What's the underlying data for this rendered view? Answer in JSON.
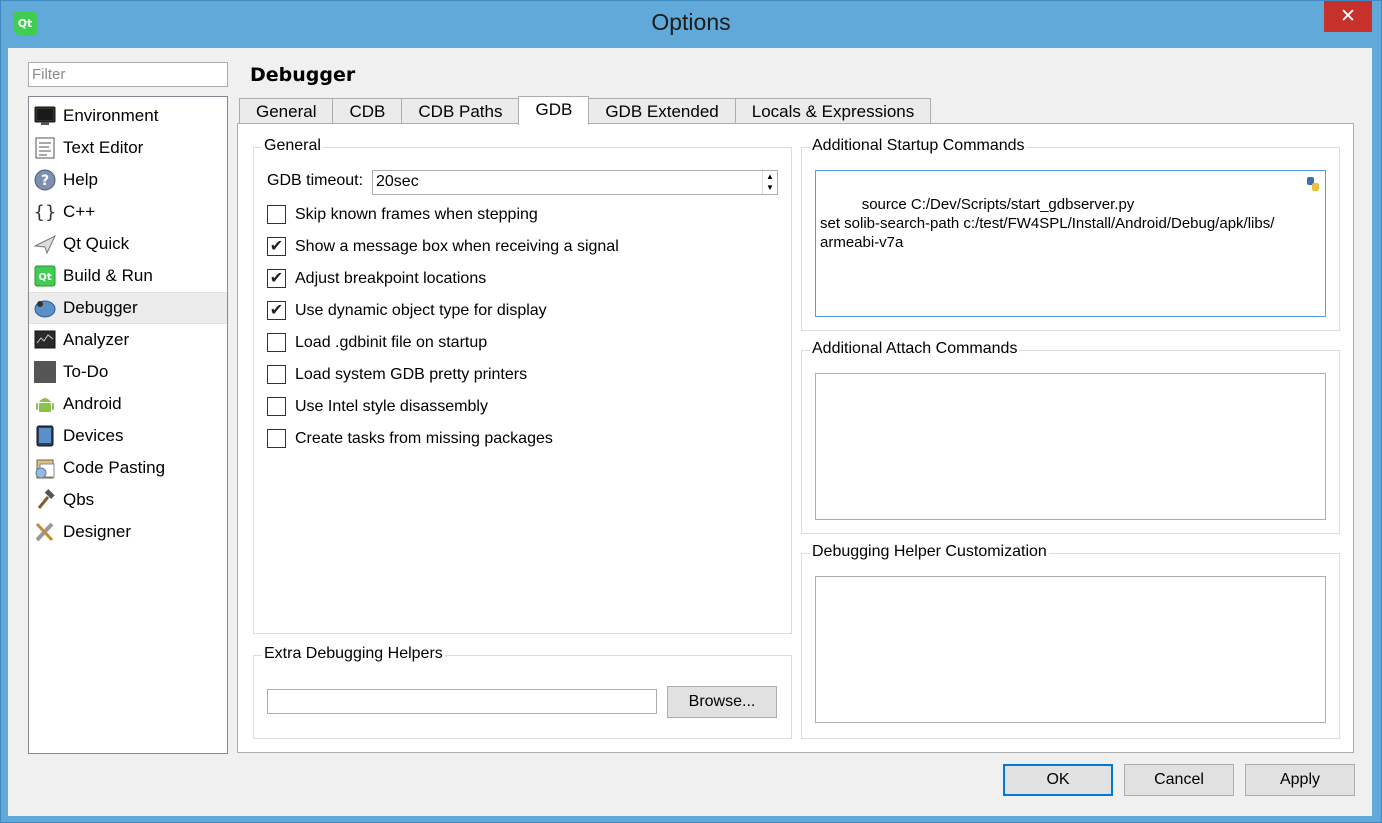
{
  "window": {
    "title": "Options",
    "app_icon_text": "Qt",
    "close_glyph": "✕"
  },
  "filter": {
    "placeholder": "Filter",
    "value": ""
  },
  "categories": [
    {
      "label": "Environment",
      "icon": "monitor-icon"
    },
    {
      "label": "Text Editor",
      "icon": "text-editor-icon"
    },
    {
      "label": "Help",
      "icon": "help-icon"
    },
    {
      "label": "C++",
      "icon": "cpp-braces-icon"
    },
    {
      "label": "Qt Quick",
      "icon": "qt-quick-icon"
    },
    {
      "label": "Build & Run",
      "icon": "build-run-icon"
    },
    {
      "label": "Debugger",
      "icon": "debugger-bug-icon",
      "selected": true
    },
    {
      "label": "Analyzer",
      "icon": "analyzer-icon"
    },
    {
      "label": "To-Do",
      "icon": "todo-icon"
    },
    {
      "label": "Android",
      "icon": "android-icon"
    },
    {
      "label": "Devices",
      "icon": "devices-icon"
    },
    {
      "label": "Code Pasting",
      "icon": "code-pasting-icon"
    },
    {
      "label": "Qbs",
      "icon": "hammer-icon"
    },
    {
      "label": "Designer",
      "icon": "designer-icon"
    }
  ],
  "page": {
    "title": "Debugger"
  },
  "tabs": [
    "General",
    "CDB",
    "CDB Paths",
    "GDB",
    "GDB Extended",
    "Locals & Expressions"
  ],
  "selected_tab": "GDB",
  "general_group": {
    "title": "General",
    "timeout_label": "GDB timeout:",
    "timeout_value": "20sec",
    "options": [
      {
        "label": "Skip known frames when stepping",
        "checked": false
      },
      {
        "label": "Show a message box when receiving a signal",
        "checked": true
      },
      {
        "label": "Adjust breakpoint locations",
        "checked": true
      },
      {
        "label": "Use dynamic object type for display",
        "checked": true
      },
      {
        "label": "Load .gdbinit file on startup",
        "checked": false
      },
      {
        "label": "Load system GDB pretty printers",
        "checked": false
      },
      {
        "label": "Use Intel style disassembly",
        "checked": false
      },
      {
        "label": "Create tasks from missing packages",
        "checked": false
      }
    ]
  },
  "extra_helpers": {
    "title": "Extra Debugging Helpers",
    "path_value": "",
    "browse_label": "Browse..."
  },
  "startup_commands": {
    "title": "Additional Startup Commands",
    "text": "source C:/Dev/Scripts/start_gdbserver.py\nset solib-search-path c:/test/FW4SPL/Install/Android/Debug/apk/libs/\narmeabi-v7a"
  },
  "attach_commands": {
    "title": "Additional Attach Commands",
    "text": ""
  },
  "helper_customization": {
    "title": "Debugging Helper Customization",
    "text": ""
  },
  "buttons": {
    "ok": "OK",
    "cancel": "Cancel",
    "apply": "Apply"
  }
}
